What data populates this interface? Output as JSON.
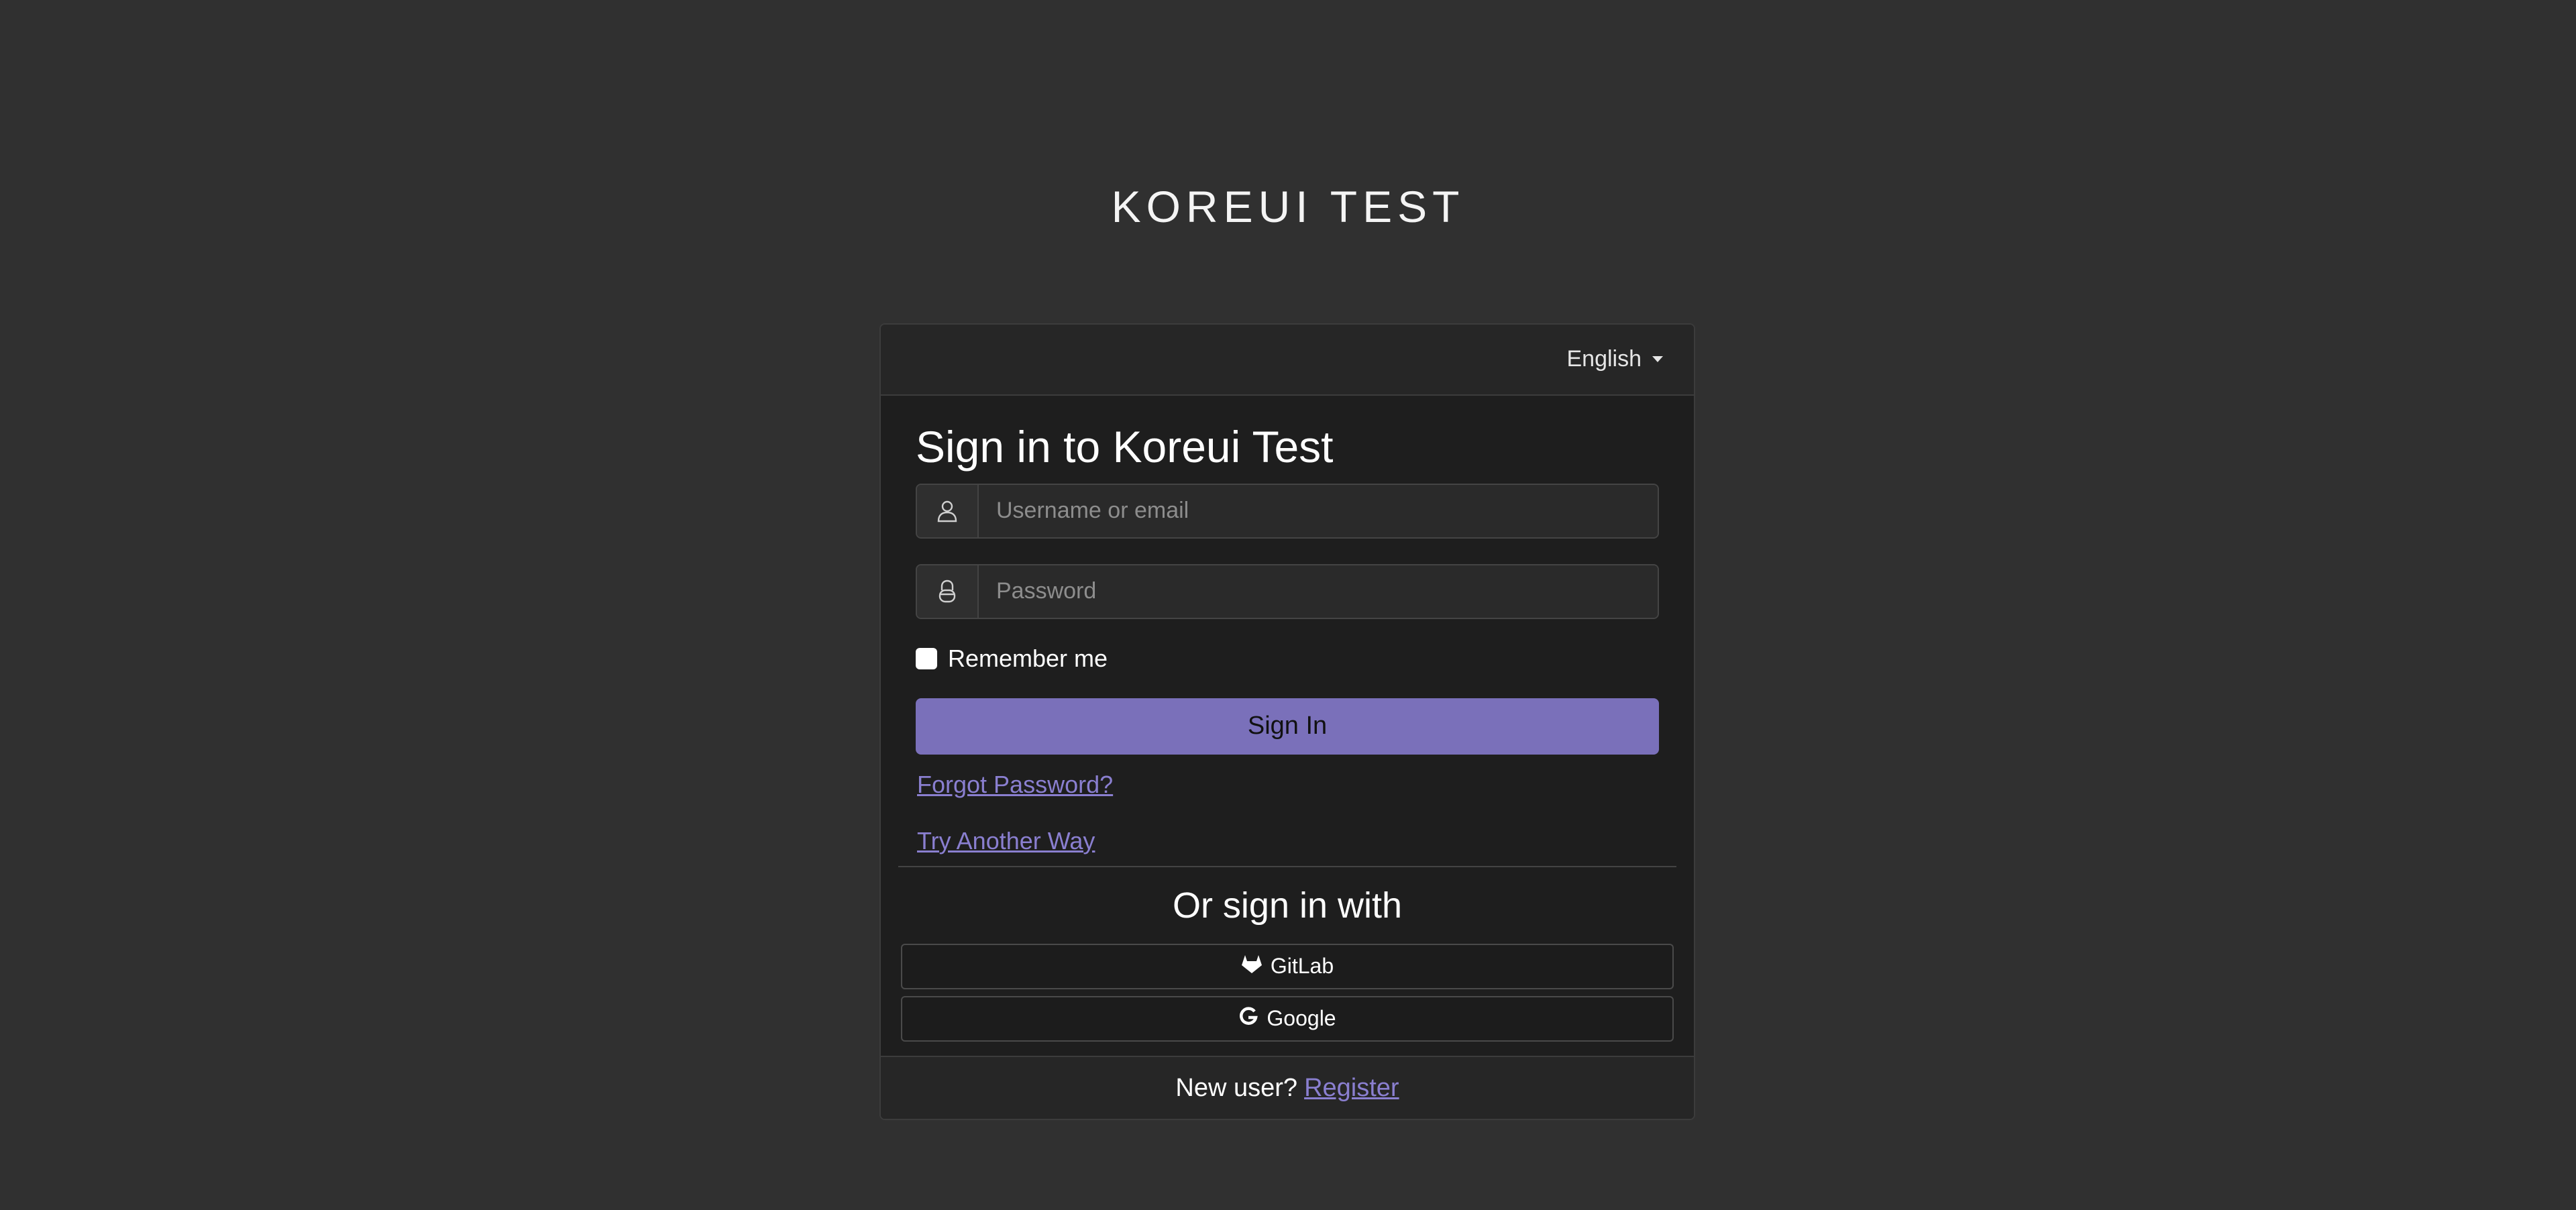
{
  "realm": {
    "title": "KOREUI TEST"
  },
  "header": {
    "language": "English"
  },
  "form": {
    "heading": "Sign in to Koreui Test",
    "username_placeholder": "Username or email",
    "password_placeholder": "Password",
    "remember_label": "Remember me",
    "signin_label": "Sign In",
    "forgot_label": "Forgot Password?",
    "try_another_label": "Try Another Way"
  },
  "social": {
    "heading": "Or sign in with",
    "providers": [
      {
        "label": "GitLab",
        "icon": "gitlab-icon"
      },
      {
        "label": "Google",
        "icon": "google-icon"
      }
    ]
  },
  "footer": {
    "new_user_text": "New user?",
    "register_label": "Register"
  },
  "colors": {
    "background": "#303030",
    "card": "#1e1e1e",
    "accent": "#7a70ba",
    "link": "#8a7fd0"
  }
}
